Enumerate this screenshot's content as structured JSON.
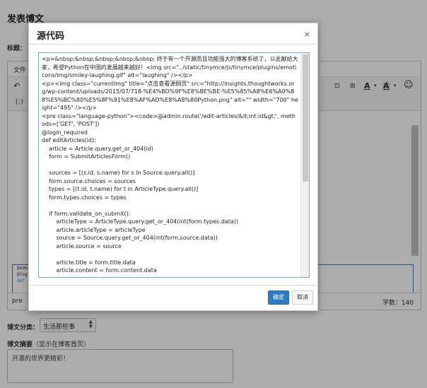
{
  "page": {
    "title": "发表博文",
    "title_label": "标题："
  },
  "editor": {
    "menu_file": "文件",
    "toolbar": {
      "undo_icon": "undo-arrow",
      "code_icon": "{;}",
      "font_color": "A",
      "bg_color": "A",
      "emoji": "☺"
    },
    "code_lines": [
      "@admi",
      "@logi",
      "def"
    ],
    "status_path": "pre",
    "word_count": "字数：140"
  },
  "category": {
    "label": "博文分类：",
    "selected": "生活那些事"
  },
  "summary": {
    "label_bold": "博文摘要",
    "label_hint": "（显示在博客首页）",
    "value": "开源的世界更精彩！"
  },
  "modal": {
    "title": "源代码",
    "close": "×",
    "source": "<p>&nbsp;&nbsp;&nbsp;&nbsp;&nbsp; 终于有一个开源而且功能强大的博客系统了，以此献给大家，希望Python在中国的发展越来越好！<img src=\"../static/tinymce/js/tinymce/plugins/emoticons/img/smiley-laughing.gif\" alt=\"laughing\" /></p>\n<p><img class=\"currentImg\" title=\"点击查看源网页\" src=\"http://insights.thoughtworks.org/wp-content/uploads/2015/07/718-%E4%BD%9F%E8%BE%BE-%E5%85%A8%E6%A0%88%E5%BC%80%E5%8F%91%E8%AF%AD%E8%A8%80Python.png\" alt=\"\" width=\"700\" height=\"495\" /></p>\n<pre class=\"language-python\"><code>@admin.route('/edit-articles/&lt;int:id&gt;', methods=['GET', 'POST'])\n@login_required\ndef editArticles(id):\n    article = Article.query.get_or_404(id)\n    form = SubmitArticlesForm()\n\n    sources = [(s.id, s.name) for s in Source.query.all()]\n    form.source.choices = sources\n    types = [(t.id, t.name) for t in ArticleType.query.all()]\n    form.types.choices = types\n\n    if form.validate_on_submit():\n        articleType = ArticleType.query.get_or_404(int(form.types.data))\n        article.articleType = articleType\n        source = Source.query.get_or_404(int(form.source.data))\n        article.source = source\n\n        article.title = form.title.data\n        article.content = form.content.data",
    "ok_label": "确定",
    "cancel_label": "取消"
  }
}
